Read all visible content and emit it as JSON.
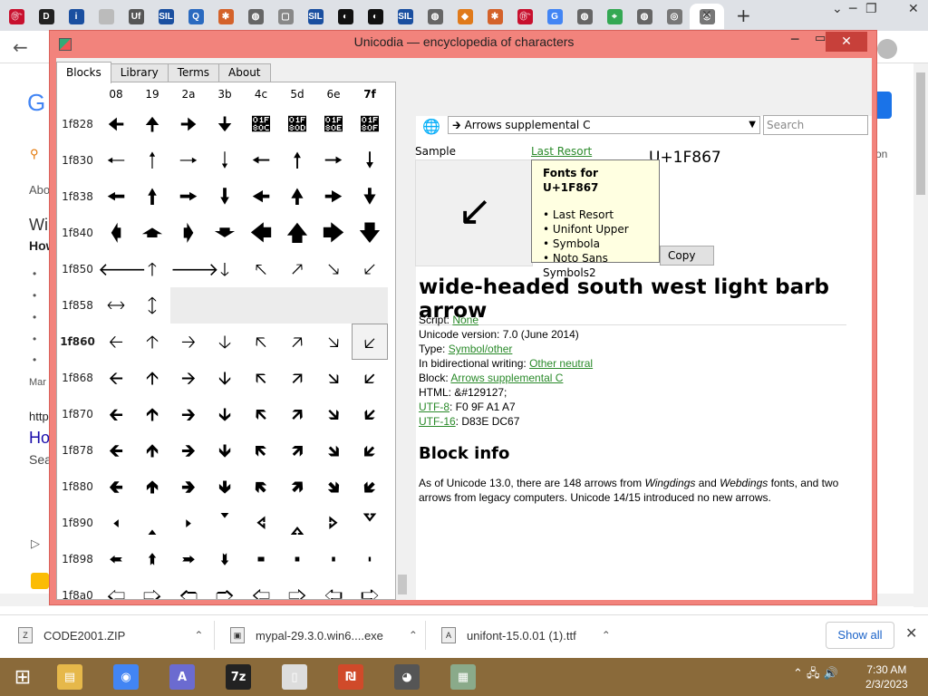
{
  "browser": {
    "tabs": [
      {
        "icon": "gem-icon",
        "color": "#c8102e",
        "text": "௹"
      },
      {
        "icon": "d-icon",
        "color": "#222222",
        "text": "D"
      },
      {
        "icon": "info-icon",
        "color": "#1a4fa0",
        "text": "i"
      },
      {
        "icon": "blank-icon",
        "color": "#bbbbbb",
        "text": ""
      },
      {
        "icon": "uf-icon",
        "color": "#555555",
        "text": "Uf"
      },
      {
        "icon": "sil-icon",
        "color": "#1a4fa0",
        "text": "SIL"
      },
      {
        "icon": "q-icon",
        "color": "#2a6ac0",
        "text": "Q"
      },
      {
        "icon": "puzzle-icon",
        "color": "#d4622a",
        "text": "✱"
      },
      {
        "icon": "globe-icon",
        "color": "#666666",
        "text": "◍"
      },
      {
        "icon": "page-icon",
        "color": "#888888",
        "text": "▢"
      },
      {
        "icon": "sil-icon",
        "color": "#1a4fa0",
        "text": "SIL"
      },
      {
        "icon": "disc-icon",
        "color": "#111111",
        "text": "◐"
      },
      {
        "icon": "disc-icon",
        "color": "#111111",
        "text": "◐"
      },
      {
        "icon": "sil-icon",
        "color": "#1a4fa0",
        "text": "SIL"
      },
      {
        "icon": "globe-icon",
        "color": "#666666",
        "text": "◍"
      },
      {
        "icon": "diamond-icon",
        "color": "#e07a1a",
        "text": "◆"
      },
      {
        "icon": "puzzle-icon",
        "color": "#d4622a",
        "text": "✱"
      },
      {
        "icon": "gem-icon",
        "color": "#c8102e",
        "text": "௹"
      },
      {
        "icon": "google-icon",
        "color": "#4285f4",
        "text": "G"
      },
      {
        "icon": "globe-icon",
        "color": "#666666",
        "text": "◍"
      },
      {
        "icon": "maps-icon",
        "color": "#34a853",
        "text": "⌖"
      },
      {
        "icon": "globe-icon",
        "color": "#666666",
        "text": "◍"
      },
      {
        "icon": "chrome-icon",
        "color": "#777777",
        "text": "◎"
      },
      {
        "icon": "chrome-icon",
        "color": "#777777",
        "text": "◎"
      }
    ],
    "close": "✕",
    "new_tab": "+",
    "win": {
      "min": "─",
      "restore": "❐",
      "close": "✕"
    },
    "back": "←",
    "behind": {
      "g": "G",
      "abo": "Abo",
      "wi": "Wi",
      "how": "How",
      "bul": "•",
      "mar": "Mar",
      "http": "http",
      "ho": "Ho",
      "sea": "Sea",
      "on": "on"
    }
  },
  "app": {
    "title": "Unicodia — encyclopedia of characters",
    "tabs": [
      "Blocks",
      "Library",
      "Terms",
      "About"
    ],
    "columns": [
      "08",
      "19",
      "2a",
      "3b",
      "4c",
      "5d",
      "6e",
      "7f"
    ],
    "rows": [
      {
        "label": "1f828",
        "cells": [
          "🠈",
          "🠉",
          "🠊",
          "🠋",
          "🠌",
          "🠍",
          "🠎",
          "🠏"
        ]
      },
      {
        "label": "1f830",
        "cells": [
          "🠐",
          "🠑",
          "🠒",
          "🠓",
          "🠔",
          "🠕",
          "🠖",
          "🠗"
        ]
      },
      {
        "label": "1f838",
        "cells": [
          "🠘",
          "🠙",
          "🠚",
          "🠛",
          "🠜",
          "🠝",
          "🠞",
          "🠟"
        ]
      },
      {
        "label": "1f840",
        "cells": [
          "🡀",
          "🡁",
          "🡂",
          "🡃",
          "🡄",
          "🡅",
          "🡆",
          "🡇"
        ]
      },
      {
        "label": "1f850",
        "cells": [
          "🡐",
          "🡑",
          "🡒",
          "🡓",
          "🡔",
          "🡕",
          "🡖",
          "🡗"
        ]
      },
      {
        "label": "1f858",
        "cells": [
          "🡘",
          "🡙",
          "",
          "",
          "",
          "",
          "",
          ""
        ]
      },
      {
        "label": "1f860",
        "cells": [
          "🡠",
          "🡡",
          "🡢",
          "🡣",
          "🡤",
          "🡥",
          "🡦",
          "🡧"
        ]
      },
      {
        "label": "1f868",
        "cells": [
          "🡨",
          "🡩",
          "🡪",
          "🡫",
          "🡬",
          "🡭",
          "🡮",
          "🡯"
        ]
      },
      {
        "label": "1f870",
        "cells": [
          "🡰",
          "🡱",
          "🡲",
          "🡳",
          "🡴",
          "🡵",
          "🡶",
          "🡷"
        ]
      },
      {
        "label": "1f878",
        "cells": [
          "🡸",
          "🡹",
          "🡺",
          "🡻",
          "🡼",
          "🡽",
          "🡾",
          "🡿"
        ]
      },
      {
        "label": "1f880",
        "cells": [
          "🢀",
          "🢁",
          "🢂",
          "🢃",
          "🢄",
          "🢅",
          "🢆",
          "🢇"
        ]
      },
      {
        "label": "1f890",
        "cells": [
          "🢐",
          "🢑",
          "🢒",
          "🢓",
          "🢔",
          "🢕",
          "🢖",
          "🢗"
        ]
      },
      {
        "label": "1f898",
        "cells": [
          "🢘",
          "🢙",
          "🢚",
          "🢛",
          "🢜",
          "🢝",
          "🢞",
          "🢟"
        ]
      },
      {
        "label": "1f8a0",
        "cells": [
          "🢠",
          "🢡",
          "🢢",
          "🢣",
          "🢤",
          "🢥",
          "🢦",
          "🢧"
        ]
      }
    ],
    "current_row": "1f860",
    "block_select": "Arrows supplemental C",
    "block_icon": "🡲",
    "search_placeholder": "Search",
    "sample_label": "Sample",
    "sample_glyph": "↙",
    "font_link": "Last Resort",
    "codepoint": "U+1F867",
    "copy_label": "Copy",
    "tooltip": {
      "title": "Fonts for U+1F867",
      "fonts": [
        "Last Resort",
        "Unifont Upper",
        "Symbola",
        "Noto Sans Symbols2"
      ]
    },
    "char_name": "wide-headed south west light barb arrow",
    "props": {
      "script_label": "Script: ",
      "script": "None",
      "version": "Unicode version: 7.0 (June 2014)",
      "type_label": "Type: ",
      "type": "Symbol/other",
      "bidi_label": "In bidirectional writing: ",
      "bidi": "Other neutral",
      "block_label": "Block: ",
      "block": "Arrows supplemental C",
      "html": "HTML: &#129127;",
      "utf8_label": "UTF-8",
      "utf8": ": F0 9F A1 A7",
      "utf16_label": "UTF-16",
      "utf16": ": D83E DC67"
    },
    "block_info_title": "Block info",
    "block_info_text_1": "As of Unicode 13.0, there are 148 arrows from ",
    "block_info_w1": "Wingdings",
    "block_info_and": " and ",
    "block_info_w2": "Webdings",
    "block_info_text_2": " fonts, and two arrows from legacy computers. Unicode 14/15 introduced no new arrows."
  },
  "downloads": [
    {
      "name": "CODE2001.ZIP",
      "icon": "zip-file-icon"
    },
    {
      "name": "mypal-29.3.0.win6....exe",
      "icon": "exe-file-icon"
    },
    {
      "name": "unifont-15.0.01 (1).ttf",
      "icon": "font-file-icon"
    }
  ],
  "show_all": "Show all",
  "taskbar": {
    "start": "⊞",
    "apps": [
      {
        "icon": "file-explorer-icon",
        "color": "#e6b84a",
        "text": "▤"
      },
      {
        "icon": "chrome-icon",
        "color": "#4285f4",
        "text": "◉"
      },
      {
        "icon": "font-app-icon",
        "color": "#6b6bd0",
        "text": "A"
      },
      {
        "icon": "7zip-icon",
        "color": "#222222",
        "text": "7z"
      },
      {
        "icon": "document-icon",
        "color": "#dddddd",
        "text": "▯"
      },
      {
        "icon": "office-icon",
        "color": "#d04a2a",
        "text": "₪"
      },
      {
        "icon": "raccoon-icon",
        "color": "#555555",
        "text": "◕"
      },
      {
        "icon": "unicodia-icon",
        "color": "#8aaa8a",
        "text": "▦"
      }
    ],
    "time": "7:30 AM",
    "date": "2/3/2023"
  }
}
